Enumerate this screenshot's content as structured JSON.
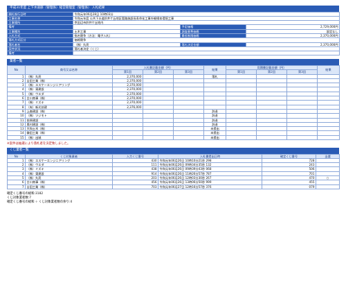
{
  "title": "平成31年度 上下水道部（管理係）経営管理室（管理係） 入札結果",
  "info": {
    "row1": {
      "label": "開札執行日時",
      "value": "令和元年06月28日 10時03分"
    },
    "row2": {
      "label": "工事名称",
      "value": "令和元年度 公共下水道鈴井ケ丘地区管路施設長寿命化工事外細線本環境工事"
    },
    "row3": {
      "label": "工事場所",
      "value": "京田辺市鈴井ケ丘地内"
    },
    "row4": {
      "label": "備考",
      "value": "",
      "label2": "予定価格",
      "value2": "2,729,000円"
    },
    "row5": {
      "label": "工事種別",
      "value": "土木工事",
      "label2": "調査基準価格",
      "value2": "設定なし"
    },
    "row6": {
      "label": "入札方式",
      "value": "指名競争（方法：電子入札）",
      "label2": "最低制限価格",
      "value2": "2,370,000円"
    },
    "row7": {
      "label": "落札方式区分",
      "value": "価格競争"
    },
    "row8": {
      "label": "落札者名",
      "value": "（株）丸亮",
      "label2": "落札決定金額",
      "value2": "2,370,000円"
    },
    "row9": {
      "label": "案件状況",
      "value": "落札者決定（くじ）"
    },
    "row10": {
      "label": "備考",
      "value": ""
    }
  },
  "bidders": {
    "section_title": "業者一覧",
    "h_no": "No",
    "h_name": "商号又は名称",
    "h_bid": "入札書記載金額（円）",
    "h_result": "結果",
    "h_rebid": "見積書記載金額（円）",
    "h_result2": "結果",
    "h_r1": "第1回",
    "h_r2": "第2回",
    "h_r3": "第3回",
    "h_s1": "第1回",
    "h_s2": "第2回",
    "h_s3": "第3回",
    "rows": [
      {
        "no": "1",
        "name": "（株）丸亮",
        "b1": "2,370,000",
        "result": "落札"
      },
      {
        "no": "2",
        "name": "吉田工業（株）",
        "b1": "2,370,000",
        "result": ""
      },
      {
        "no": "3",
        "name": "（株）エスケーエンジニアリング",
        "b1": "2,370,000",
        "result": ""
      },
      {
        "no": "4",
        "name": "（株）東建設",
        "b1": "2,370,000",
        "result": ""
      },
      {
        "no": "5",
        "name": "（株）ウエダ",
        "b1": "2,370,000",
        "result": ""
      },
      {
        "no": "6",
        "name": "古川商事（株）",
        "b1": "2,370,000",
        "result": ""
      },
      {
        "no": "7",
        "name": "（株）ミズキ",
        "b1": "2,370,000",
        "result": ""
      },
      {
        "no": "8",
        "name": "（有）新光技建",
        "b1": "2,376,000",
        "result": ""
      },
      {
        "no": "9",
        "name": "上森建設（株）",
        "b1": "",
        "result": "辞退"
      },
      {
        "no": "10",
        "name": "（株）ツジモト",
        "b1": "",
        "result": "辞退"
      },
      {
        "no": "11",
        "name": "前原建設",
        "b1": "",
        "result": "辞退"
      },
      {
        "no": "12",
        "name": "奥村建設（株）",
        "b1": "",
        "result": "辞退"
      },
      {
        "no": "13",
        "name": "大和土木（株）",
        "b1": "",
        "result": "未提出"
      },
      {
        "no": "14",
        "name": "鎌田工業（株）",
        "b1": "",
        "result": "未提出"
      },
      {
        "no": "15",
        "name": "（株）出城",
        "b1": "",
        "result": "未提出"
      }
    ]
  },
  "note": "※案件は抽選により落札者を決定致しました。",
  "kuji": {
    "section_title": "くじ業者一覧",
    "h_no": "No",
    "h_name": "くじ対象業者",
    "h_num": "入力くじ番号",
    "h_date": "入札書提出日時",
    "h_conf": "確定くじ番号",
    "h_win": "当選",
    "rows": [
      {
        "no": "1",
        "name": "（株）エスケーエンジニアリング",
        "num": "430",
        "date": "令和元年06月26日 10時10分21秒 298",
        "conf": "728",
        "win": ""
      },
      {
        "no": "2",
        "name": "（株）ウエダ",
        "num": "111",
        "date": "令和元年06月26日 09時34分35秒 132",
        "conf": "243",
        "win": ""
      },
      {
        "no": "3",
        "name": "（株）ミズキ",
        "num": "438",
        "date": "令和元年06月26日 09時39分43秒 068",
        "conf": "506",
        "win": ""
      },
      {
        "no": "4",
        "name": "（株）東建設",
        "num": "914",
        "date": "令和元年06月26日 11時26分57秒 787",
        "conf": "701",
        "win": ""
      },
      {
        "no": "5",
        "name": "（株）丸亮",
        "num": "203",
        "date": "令和元年06月26日 12時03分30秒 267",
        "conf": "470",
        "win": "○"
      },
      {
        "no": "6",
        "name": "古川商事（株）",
        "num": "456",
        "date": "令和元年06月26日 13時06分50秒 999",
        "conf": "455",
        "win": ""
      },
      {
        "no": "7",
        "name": "吉田工業（株）",
        "num": "703",
        "date": "令和元年06月27日 12時16分57秒 376",
        "conf": "079",
        "win": ""
      }
    ]
  },
  "footer": {
    "line1": "確定くじ番号の総和:3182",
    "line2": "くじ対象業者数:7",
    "line3": "確定くじ番号の総和 ÷ くじ対象業者数の余り:4"
  },
  "colors": {
    "header": "#2a5bb5",
    "subheader": "#dbe6f8",
    "border": "#8aa6d8"
  }
}
